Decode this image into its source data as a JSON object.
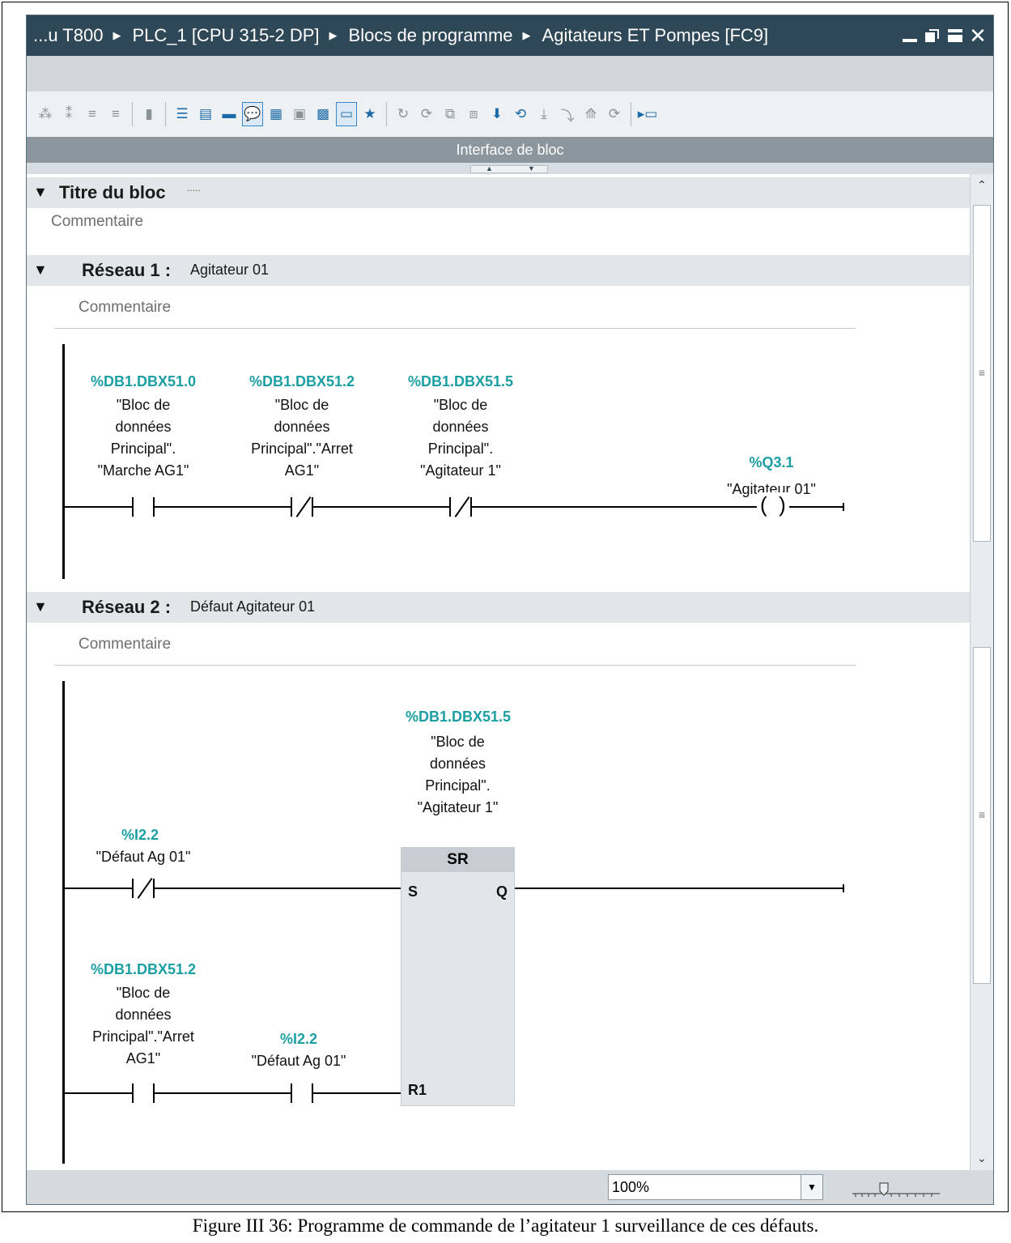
{
  "window": {
    "breadcrumb": [
      "...u T800",
      "PLC_1 [CPU 315-2 DP]",
      "Blocs de programme",
      "Agitateurs ET Pompes [FC9]"
    ],
    "separator_icon": "arrow-right-icon"
  },
  "toolbar": {
    "interface_label": "Interface de bloc"
  },
  "block": {
    "title": "Titre du bloc",
    "title_dots": ".....",
    "comment": "Commentaire"
  },
  "networks": [
    {
      "label": "Réseau 1 :",
      "title": "Agitateur 01",
      "comment": "Commentaire",
      "contacts": [
        {
          "type": "NO",
          "address": "%DB1.DBX51.0",
          "symbol": [
            "\"Bloc de",
            "données",
            "Principal\".",
            "\"Marche  AG1\""
          ]
        },
        {
          "type": "NC",
          "address": "%DB1.DBX51.2",
          "symbol": [
            "\"Bloc de",
            "données",
            "Principal\".\"Arret",
            "AG1\""
          ]
        },
        {
          "type": "NC",
          "address": "%DB1.DBX51.5",
          "symbol": [
            "\"Bloc de",
            "données",
            "Principal\".",
            "\"Agitateur 1\""
          ]
        }
      ],
      "coil": {
        "address": "%Q3.1",
        "symbol": "\"Agitateur 01\""
      }
    },
    {
      "label": "Réseau 2 :",
      "title": "Défaut Agitateur 01",
      "comment": "Commentaire",
      "sr_block": {
        "name": "SR",
        "address": "%DB1.DBX51.5",
        "symbol": [
          "\"Bloc de",
          "données",
          "Principal\".",
          "\"Agitateur 1\""
        ],
        "pin_s": "S",
        "pin_r": "R1",
        "pin_q": "Q"
      },
      "set_contact": {
        "type": "NC",
        "address": "%I2.2",
        "symbol": "\"Défaut Ag 01\""
      },
      "reset_contacts": [
        {
          "type": "NO",
          "address": "%DB1.DBX51.2",
          "symbol": [
            "\"Bloc de",
            "données",
            "Principal\".\"Arret",
            "AG1\""
          ]
        },
        {
          "type": "NO",
          "address": "%I2.2",
          "symbol": "\"Défaut Ag 01\""
        }
      ]
    }
  ],
  "statusbar": {
    "zoom": "100%"
  },
  "caption": "Figure III 36: Programme de commande de l’agitateur 1 surveillance de ces défauts.",
  "colors": {
    "titlebar": "#2f4858",
    "address": "#1c9fa3",
    "header": "#e3e6e8",
    "sr_block": "#e2e5ea"
  }
}
